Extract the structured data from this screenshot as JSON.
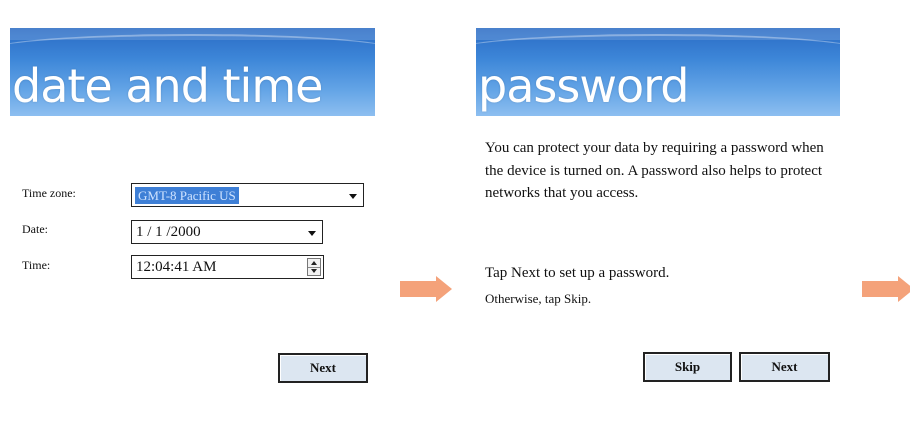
{
  "date_time_screen": {
    "title": "date and time",
    "time_zone_label": "Time zone:",
    "time_zone_value": "GMT-8 Pacific US",
    "date_label": "Date:",
    "date_value": "1 / 1 /2000",
    "time_label": "Time:",
    "time_value": "12:04:41 AM",
    "next_label": "Next"
  },
  "password_screen": {
    "title": "password",
    "description": "You can protect your data by requiring a password when the device is turned on. A password also helps to protect networks that you access.",
    "tap_next_text": "Tap Next to set up a password.",
    "otherwise_text": "Otherwise, tap Skip.",
    "skip_label": "Skip",
    "next_label": "Next"
  },
  "colors": {
    "banner": "#3d86d8",
    "button_bg": "#dce6f1",
    "arrow": "#f4a27a",
    "selection": "#3e7fd6"
  },
  "icons": [
    "dropdown-arrow-icon",
    "spinner-up-icon",
    "spinner-down-icon",
    "next-step-arrow-icon"
  ]
}
